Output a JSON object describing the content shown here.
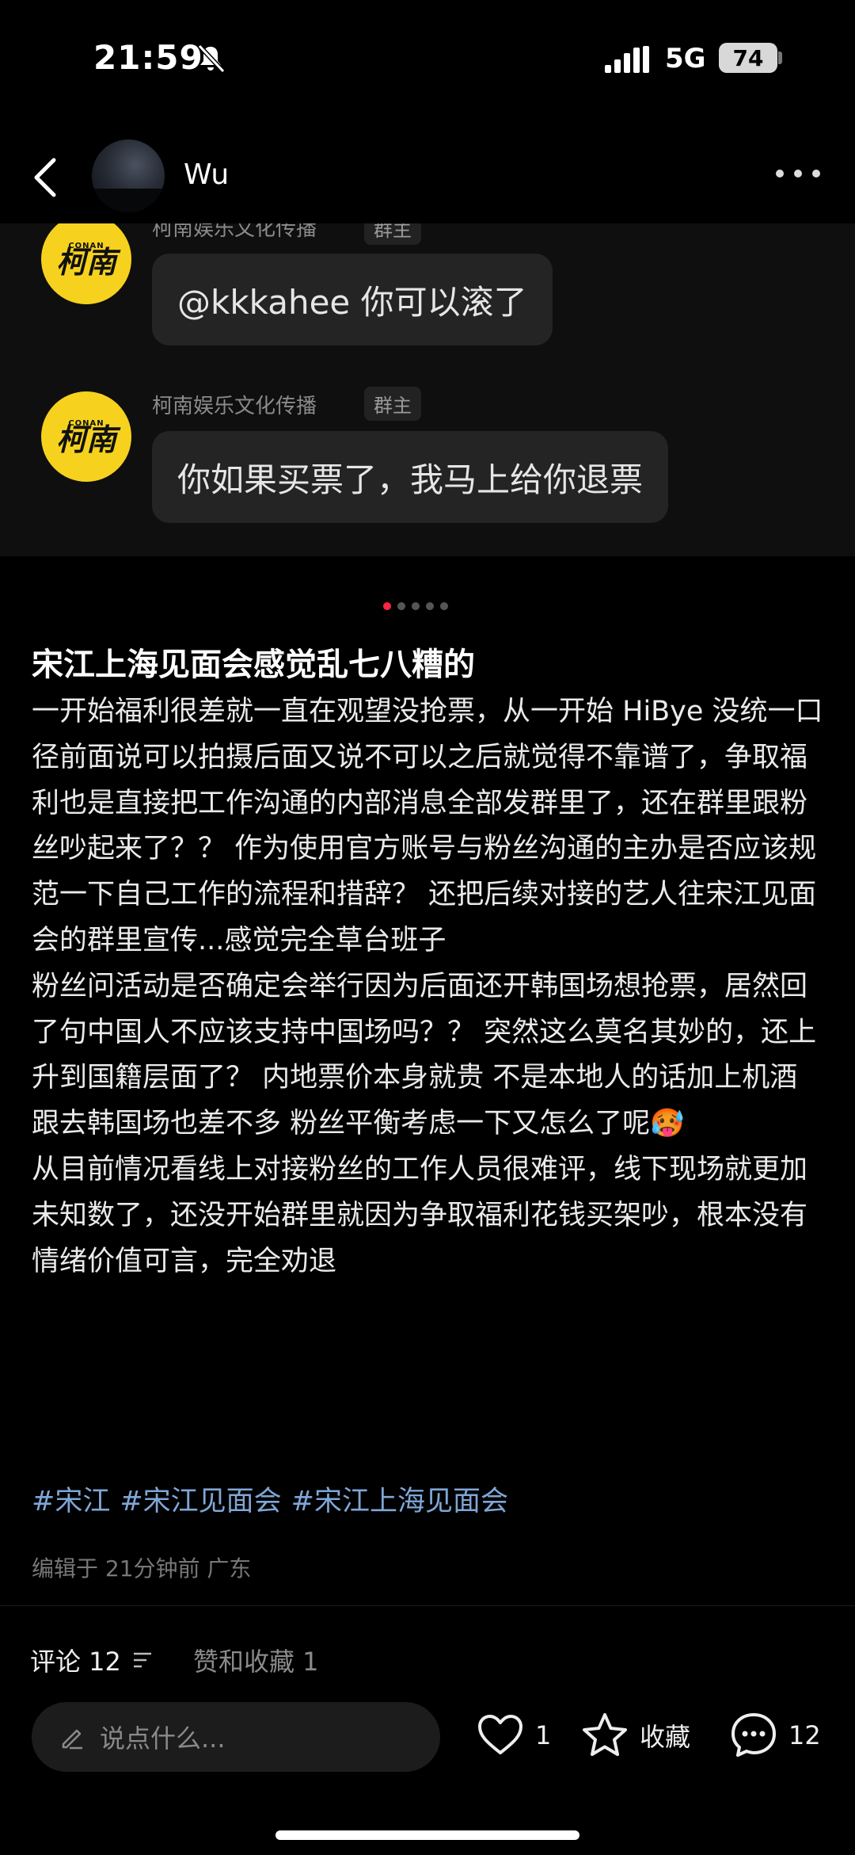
{
  "status_bar": {
    "time": "21:59",
    "network": "5G",
    "battery": "74"
  },
  "header": {
    "user_name": "Wu",
    "back_icon": "chevron-left-icon",
    "more_icon": "more-dots-icon"
  },
  "chat_image": {
    "messages": [
      {
        "sender": "柯南娱乐文化传播",
        "role": "群主",
        "logo_text": "柯南",
        "logo_small": "CONAN",
        "text": "@kkkahee 你可以滚了"
      },
      {
        "sender": "柯南娱乐文化传播",
        "role": "群主",
        "logo_text": "柯南",
        "logo_small": "CONAN",
        "text": "你如果买票了，我马上给你退票"
      }
    ],
    "page_count": 5,
    "current_page": 1
  },
  "note": {
    "title": "宋江上海见面会感觉乱七八糟的",
    "paragraphs": [
      "一开始福利很差就一直在观望没抢票，从一开始 HiBye 没统一口径前面说可以拍摄后面又说不可以之后就觉得不靠谱了，争取福利也是直接把工作沟通的内部消息全部发群里了，还在群里跟粉丝吵起来了？？ 作为使用官方账号与粉丝沟通的主办是否应该规范一下自己工作的流程和措辞？ 还把后续对接的艺人往宋江见面会的群里宣传...感觉完全草台班子",
      "粉丝问活动是否确定会举行因为后面还开韩国场想抢票，居然回了句中国人不应该支持中国场吗？？ 突然这么莫名其妙的，还上升到国籍层面了？ 内地票价本身就贵 不是本地人的话加上机酒跟去韩国场也差不多 粉丝平衡考虑一下又怎么了呢🥵",
      "从目前情况看线上对接粉丝的工作人员很难评，线下现场就更加未知数了，还没开始群里就因为争取福利花钱买架吵，根本没有情绪价值可言，完全劝退"
    ],
    "tags": [
      "#宋江",
      "#宋江见面会",
      "#宋江上海见面会"
    ],
    "meta": "编辑于 21分钟前 广东"
  },
  "tabs": {
    "comments": "评论 12",
    "likes": "赞和收藏 1"
  },
  "bottom_bar": {
    "input_placeholder": "说点什么...",
    "like_count": "1",
    "favorite_label": "收藏",
    "comment_count": "12"
  },
  "colors": {
    "accent": "#ff2442",
    "tag": "#7fa6d6",
    "logo": "#f6d21e"
  }
}
